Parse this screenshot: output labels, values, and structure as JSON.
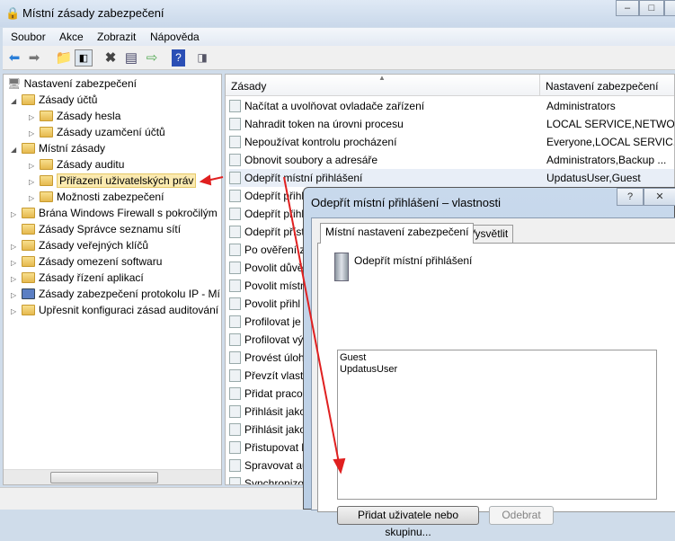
{
  "window": {
    "title": "Místní zásady zabezpečení",
    "minimize": "–",
    "maximize": "□",
    "close": "✕"
  },
  "menu": [
    "Soubor",
    "Akce",
    "Zobrazit",
    "Nápověda"
  ],
  "toolbar": [
    "back-icon",
    "forward-icon",
    "up-folder-icon",
    "show-hide-tree-icon",
    "delete-icon",
    "properties-icon",
    "export-icon",
    "help-icon",
    "show-action-pane-icon"
  ],
  "tree": [
    {
      "label": "Nastavení zabezpečení",
      "level": 0
    },
    {
      "label": "Zásady účtů",
      "level": 1
    },
    {
      "label": "Zásady hesla",
      "level": 2
    },
    {
      "label": "Zásady uzamčení účtů",
      "level": 2
    },
    {
      "label": "Místní zásady",
      "level": 1
    },
    {
      "label": "Zásady auditu",
      "level": 2
    },
    {
      "label": "Přiřazení uživatelských práv",
      "level": 2
    },
    {
      "label": "Možnosti zabezpečení",
      "level": 2
    },
    {
      "label": "Brána Windows Firewall s pokročilým",
      "level": 1
    },
    {
      "label": "Zásady Správce seznamu sítí",
      "level": 1
    },
    {
      "label": "Zásady veřejných klíčů",
      "level": 1
    },
    {
      "label": "Zásady omezení softwaru",
      "level": 1
    },
    {
      "label": "Zásady řízení aplikací",
      "level": 1
    },
    {
      "label": "Zásady zabezpečení protokolu IP - Mí",
      "level": 1
    },
    {
      "label": "Upřesnit konfiguraci zásad auditování",
      "level": 1
    }
  ],
  "columns": {
    "policy": "Zásady",
    "setting": "Nastavení zabezpečení"
  },
  "rows": [
    {
      "policy": "Načítat a uvolňovat ovladače zařízení",
      "setting": "Administrators"
    },
    {
      "policy": "Nahradit token na úrovni procesu",
      "setting": "LOCAL SERVICE,NETWO..."
    },
    {
      "policy": "Nepoužívat kontrolu procházení",
      "setting": "Everyone,LOCAL SERVIC..."
    },
    {
      "policy": "Obnovit soubory a adresáře",
      "setting": "Administrators,Backup ..."
    },
    {
      "policy": "Odepřít místní přihlášení",
      "setting": "UpdatusUser,Guest"
    },
    {
      "policy": "Odepřít přihl",
      "setting": ""
    },
    {
      "policy": "Odepřít přihl",
      "setting": ""
    },
    {
      "policy": "Odepřít příst",
      "setting": ""
    },
    {
      "policy": "Po ověření z",
      "setting": ""
    },
    {
      "policy": "Povolit důvě",
      "setting": ""
    },
    {
      "policy": "Povolit místn",
      "setting": ""
    },
    {
      "policy": "Povolit přihl",
      "setting": ""
    },
    {
      "policy": "Profilovat je",
      "setting": ""
    },
    {
      "policy": "Profilovat vý",
      "setting": ""
    },
    {
      "policy": "Provést úloh",
      "setting": ""
    },
    {
      "policy": "Převzít vlastn",
      "setting": ""
    },
    {
      "policy": "Přidat praco",
      "setting": ""
    },
    {
      "policy": "Přihlásit jako",
      "setting": ""
    },
    {
      "policy": "Přihlásit jako",
      "setting": ""
    },
    {
      "policy": "Přistupovat k",
      "setting": ""
    },
    {
      "policy": "Spravovat au",
      "setting": ""
    },
    {
      "policy": "Synchronizo",
      "setting": ""
    }
  ],
  "dialog": {
    "title": "Odepřít místní přihlášení – vlastnosti",
    "help": "?",
    "close": "✕",
    "tabs": [
      "Místní nastavení zabezpečení",
      "Vysvětlit"
    ],
    "policy_name": "Odepřít místní přihlášení",
    "members": [
      "Guest",
      "UpdatusUser"
    ],
    "add_button": "Přidat uživatele nebo skupinu...",
    "remove_button": "Odebrat"
  },
  "colors": {
    "annotation": "#e02020",
    "selection": "#fbeab0"
  }
}
